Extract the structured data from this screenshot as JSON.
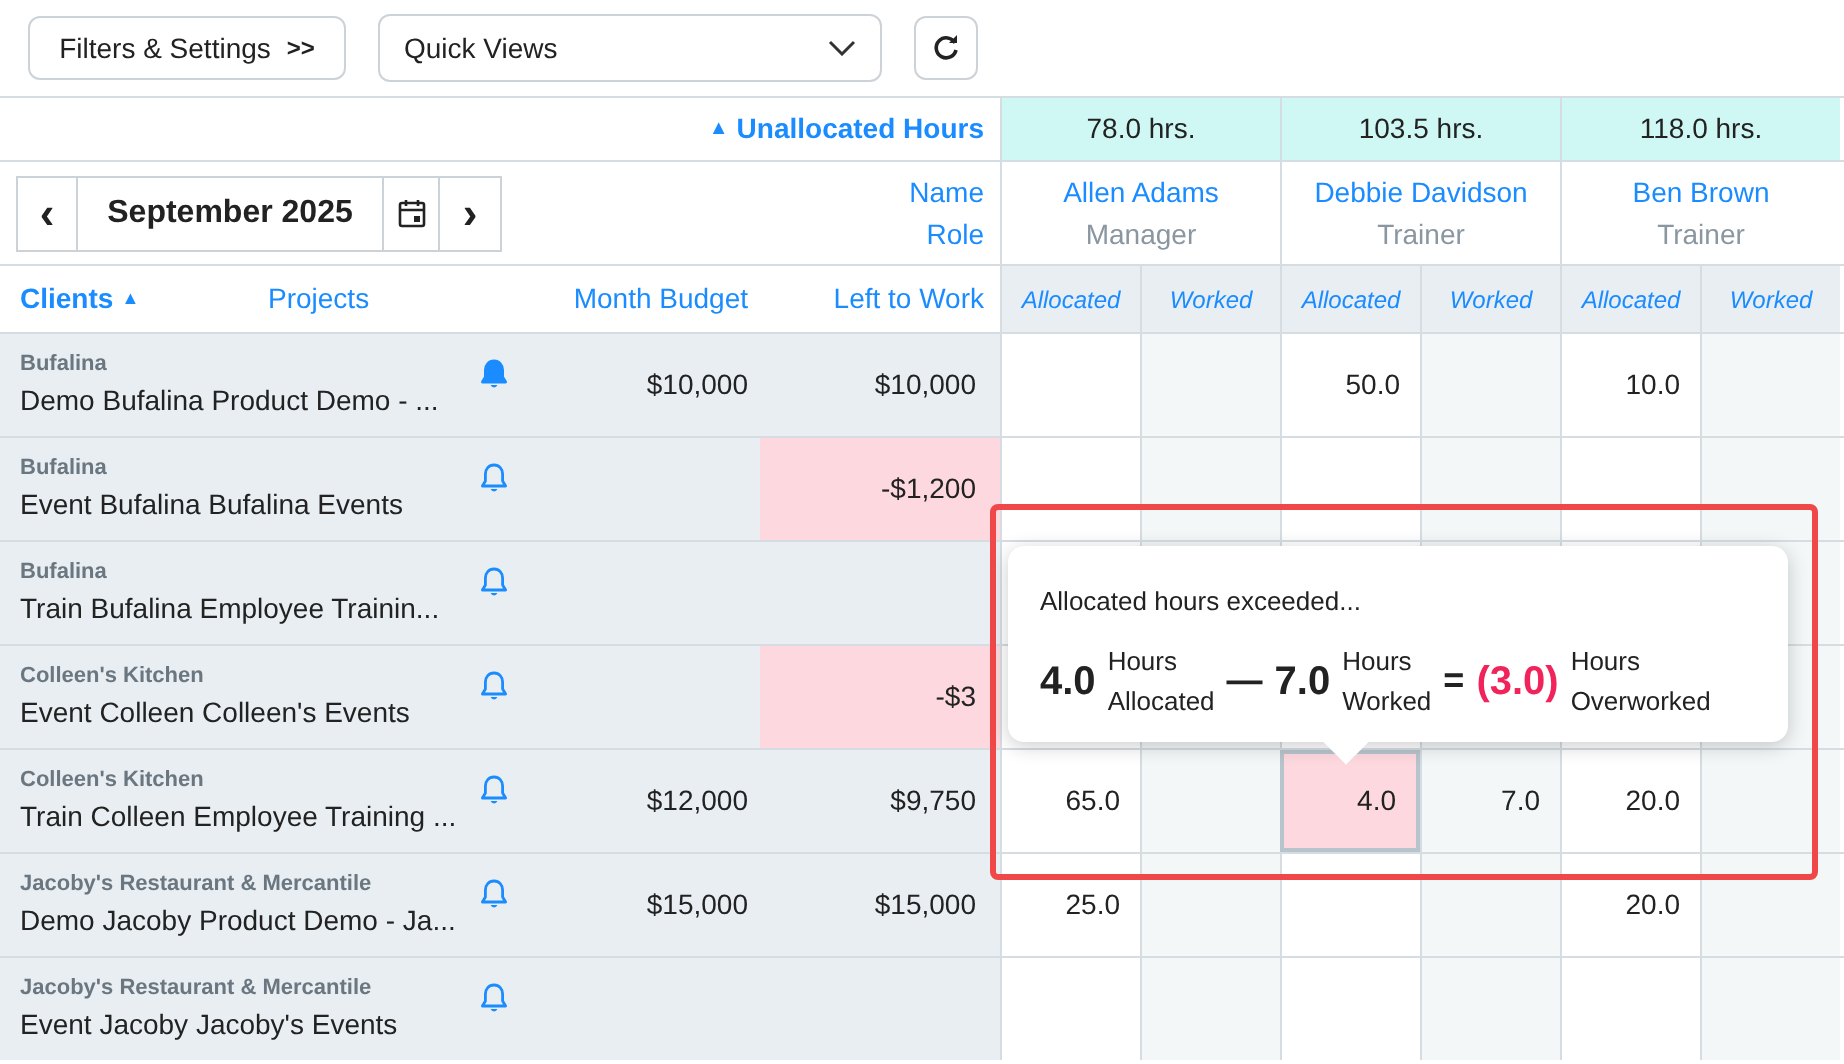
{
  "toolbar": {
    "filters_button": "Filters & Settings",
    "filters_chevron": ">>",
    "quick_views": {
      "value": "Quick Views"
    }
  },
  "unallocated": {
    "label": "Unallocated Hours",
    "sort_arrow": "▲"
  },
  "month_nav": {
    "prev": "‹",
    "month": "September 2025",
    "next": "›"
  },
  "person_header": {
    "name_label": "Name",
    "role_label": "Role"
  },
  "people": [
    {
      "hours": "78.0 hrs.",
      "name": "Allen Adams",
      "role": "Manager",
      "columns": [
        "Allocated",
        "Worked"
      ]
    },
    {
      "hours": "103.5 hrs.",
      "name": "Debbie Davidson",
      "role": "Trainer",
      "columns": [
        "Allocated",
        "Worked"
      ]
    },
    {
      "hours": "118.0 hrs.",
      "name": "Ben Brown",
      "role": "Trainer",
      "columns": [
        "Allocated",
        "Worked"
      ]
    }
  ],
  "columns": {
    "clients": "Clients",
    "clients_sort": "▲",
    "projects": "Projects",
    "month_budget": "Month Budget",
    "left_to_work": "Left to Work"
  },
  "rows": [
    {
      "client": "Bufalina",
      "project": "Demo Bufalina Product Demo - ...",
      "alert_on": true,
      "budget": "$10,000",
      "left": "$10,000",
      "over_budget": false,
      "hours": {
        "p2_allocated": {
          "value": "50.0",
          "exceeded": false
        },
        "p3_allocated": {
          "value": "10.0",
          "exceeded": false
        }
      }
    },
    {
      "client": "Bufalina",
      "project": "Event Bufalina Bufalina Events",
      "alert_on": false,
      "left": "-$1,200",
      "over_budget": true
    },
    {
      "client": "Bufalina",
      "project": "Train Bufalina Employee Trainin...",
      "alert_on": false,
      "over_budget": false
    },
    {
      "client": "Colleen's Kitchen",
      "project": "Event Colleen Colleen's Events",
      "alert_on": false,
      "left": "-$3",
      "over_budget": true
    },
    {
      "client": "Colleen's Kitchen",
      "project": "Train Colleen Employee Training ...",
      "alert_on": false,
      "budget": "$12,000",
      "left": "$9,750",
      "over_budget": false,
      "hours": {
        "p1_allocated": {
          "value": "65.0",
          "exceeded": false
        },
        "p2_allocated": {
          "value": "4.0",
          "exceeded": true
        },
        "p2_worked": {
          "value": "7.0",
          "exceeded": false
        },
        "p3_allocated": {
          "value": "20.0",
          "exceeded": false
        }
      }
    },
    {
      "client": "Jacoby's Restaurant & Mercantile",
      "project": "Demo Jacoby Product Demo - Ja...",
      "alert_on": false,
      "budget": "$15,000",
      "left": "$15,000",
      "over_budget": false,
      "hours": {
        "p1_allocated": {
          "value": "25.0",
          "exceeded": false
        },
        "p3_allocated": {
          "value": "20.0",
          "exceeded": false
        }
      }
    },
    {
      "client": "Jacoby's Restaurant & Mercantile",
      "project": "Event Jacoby Jacoby's Events",
      "alert_on": false,
      "over_budget": false
    }
  ],
  "tooltip": {
    "title": "Allocated hours exceeded...",
    "allocated": "4.0",
    "allocated_label_1": "Hours",
    "allocated_label_2": "Allocated",
    "minus": "—",
    "worked": "7.0",
    "worked_label_1": "Hours",
    "worked_label_2": "Worked",
    "equals": "=",
    "result": "(3.0)",
    "result_label_1": "Hours",
    "result_label_2": "Overworked"
  }
}
